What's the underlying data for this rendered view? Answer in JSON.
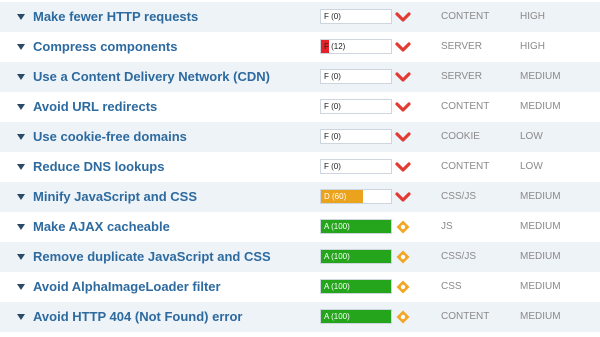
{
  "colors": {
    "fail_fill": "#e8202a",
    "d_fill": "#eba21c",
    "a_fill": "#24a51c",
    "chevron_red": "#e23b33",
    "diamond_orange": "#f3a623",
    "rule_link": "#2d6a9f"
  },
  "rules": [
    {
      "name": "Make fewer HTTP requests",
      "grade_text": "F (0)",
      "score": 0,
      "grade": "F",
      "status_icon": "chevron-down-icon",
      "category": "CONTENT",
      "priority": "HIGH"
    },
    {
      "name": "Compress components",
      "grade_text": "F (12)",
      "score": 12,
      "grade": "F",
      "status_icon": "chevron-down-icon",
      "category": "SERVER",
      "priority": "HIGH"
    },
    {
      "name": "Use a Content Delivery Network (CDN)",
      "grade_text": "F (0)",
      "score": 0,
      "grade": "F",
      "status_icon": "chevron-down-icon",
      "category": "SERVER",
      "priority": "MEDIUM"
    },
    {
      "name": "Avoid URL redirects",
      "grade_text": "F (0)",
      "score": 0,
      "grade": "F",
      "status_icon": "chevron-down-icon",
      "category": "CONTENT",
      "priority": "MEDIUM"
    },
    {
      "name": "Use cookie-free domains",
      "grade_text": "F (0)",
      "score": 0,
      "grade": "F",
      "status_icon": "chevron-down-icon",
      "category": "COOKIE",
      "priority": "LOW"
    },
    {
      "name": "Reduce DNS lookups",
      "grade_text": "F (0)",
      "score": 0,
      "grade": "F",
      "status_icon": "chevron-down-icon",
      "category": "CONTENT",
      "priority": "LOW"
    },
    {
      "name": "Minify JavaScript and CSS",
      "grade_text": "D (60)",
      "score": 60,
      "grade": "D",
      "status_icon": "chevron-down-icon",
      "category": "CSS/JS",
      "priority": "MEDIUM"
    },
    {
      "name": "Make AJAX cacheable",
      "grade_text": "A (100)",
      "score": 100,
      "grade": "A",
      "status_icon": "diamond-icon",
      "category": "JS",
      "priority": "MEDIUM"
    },
    {
      "name": "Remove duplicate JavaScript and CSS",
      "grade_text": "A (100)",
      "score": 100,
      "grade": "A",
      "status_icon": "diamond-icon",
      "category": "CSS/JS",
      "priority": "MEDIUM"
    },
    {
      "name": "Avoid AlphaImageLoader filter",
      "grade_text": "A (100)",
      "score": 100,
      "grade": "A",
      "status_icon": "diamond-icon",
      "category": "CSS",
      "priority": "MEDIUM"
    },
    {
      "name": "Avoid HTTP 404 (Not Found) error",
      "grade_text": "A (100)",
      "score": 100,
      "grade": "A",
      "status_icon": "diamond-icon",
      "category": "CONTENT",
      "priority": "MEDIUM"
    }
  ]
}
